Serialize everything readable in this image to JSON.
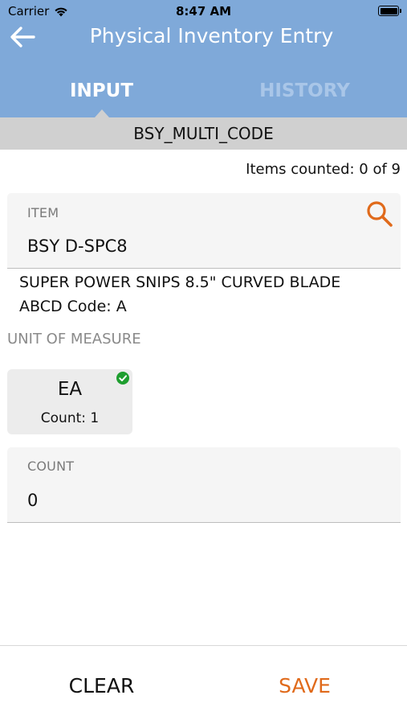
{
  "status_bar": {
    "carrier": "Carrier",
    "time": "8:47 AM"
  },
  "nav": {
    "title": "Physical Inventory Entry",
    "back_icon": "arrow-left-icon"
  },
  "tabs": [
    {
      "label": "INPUT",
      "active": true
    },
    {
      "label": "HISTORY",
      "active": false
    }
  ],
  "group_code": "BSY_MULTI_CODE",
  "items_counted": "Items counted: 0 of 9",
  "item_field": {
    "label": "ITEM",
    "value": "BSY D-SPC8",
    "search_icon": "search-icon"
  },
  "item_description": "SUPER POWER SNIPS 8.5\" CURVED BLADE",
  "abcd_code": "ABCD Code: A",
  "unit_of_measure": {
    "label": "UNIT OF MEASURE",
    "options": [
      {
        "code": "EA",
        "count": "Count: 1",
        "selected": true
      }
    ]
  },
  "count_field": {
    "label": "COUNT",
    "value": "0"
  },
  "footer": {
    "clear_label": "CLEAR",
    "save_label": "SAVE"
  },
  "colors": {
    "header_bg": "#7fa9d9",
    "accent": "#e06a1b",
    "check": "#1e9e2f",
    "group_bar": "#d0d0d0"
  }
}
